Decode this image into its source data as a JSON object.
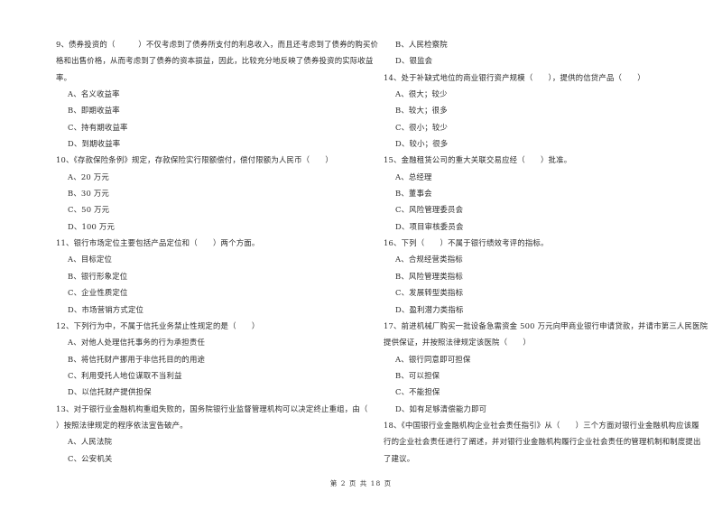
{
  "left_column": [
    {
      "type": "question",
      "lines": [
        "9、债券投资的（　　　）不仅考虑到了债券所支付的利息收入，而且还考虑到了债券的购买价",
        "格和出售价格，从而考虑到了债券的资本损益，因此，比较充分地反映了债券投资的实际收益",
        "率。"
      ]
    },
    {
      "type": "option",
      "text": "A、名义收益率"
    },
    {
      "type": "option",
      "text": "B、即期收益率"
    },
    {
      "type": "option",
      "text": "C、持有期收益率"
    },
    {
      "type": "option",
      "text": "D、到期收益率"
    },
    {
      "type": "question",
      "lines": [
        "10、《存款保险条例》规定，存款保险实行限额偿付，偿付限额为人民币（　　）"
      ]
    },
    {
      "type": "option",
      "text": "A、20 万元"
    },
    {
      "type": "option",
      "text": "B、30 万元"
    },
    {
      "type": "option",
      "text": "C、50 万元"
    },
    {
      "type": "option",
      "text": "D、100 万元"
    },
    {
      "type": "question",
      "lines": [
        "11、银行市场定位主要包括产品定位和（　　）两个方面。"
      ]
    },
    {
      "type": "option",
      "text": "A、目标定位"
    },
    {
      "type": "option",
      "text": "B、银行形象定位"
    },
    {
      "type": "option",
      "text": "C、企业性质定位"
    },
    {
      "type": "option",
      "text": "D、市场营销方式定位"
    },
    {
      "type": "question",
      "lines": [
        "12、下列行为中，不属于信托业务禁止性规定的是（　　）"
      ]
    },
    {
      "type": "option",
      "text": "A、对他人处理信托事务的行为承担责任"
    },
    {
      "type": "option",
      "text": "B、将信托财产挪用于非信托目的的用途"
    },
    {
      "type": "option",
      "text": "C、利用受托人地位谋取不当利益"
    },
    {
      "type": "option",
      "text": "D、以信托财产提供担保"
    },
    {
      "type": "question",
      "lines": [
        "13、对于银行业金融机构重组失败的，国务院银行业监督管理机构可以决定终止重组，由（",
        "）按照法律规定的程序依法宣告破产。"
      ]
    },
    {
      "type": "option",
      "text": "A、人民法院"
    },
    {
      "type": "option",
      "text": "C、公安机关"
    }
  ],
  "right_column": [
    {
      "type": "option",
      "text": "B、人民检察院"
    },
    {
      "type": "option",
      "text": "D、银监会"
    },
    {
      "type": "question",
      "lines": [
        "14、处于补缺式地位的商业银行资产规模（　　），提供的信贷产品（　　）"
      ]
    },
    {
      "type": "option",
      "text": "A、很大；较少"
    },
    {
      "type": "option",
      "text": "B、较大；很多"
    },
    {
      "type": "option",
      "text": "C、很小；较少"
    },
    {
      "type": "option",
      "text": "D、较小；很多"
    },
    {
      "type": "question",
      "lines": [
        "15、金融租赁公司的重大关联交易应经（　　）批准。"
      ]
    },
    {
      "type": "option",
      "text": "A、总经理"
    },
    {
      "type": "option",
      "text": "B、董事会"
    },
    {
      "type": "option",
      "text": "C、风险管理委员会"
    },
    {
      "type": "option",
      "text": "D、项目审核委员会"
    },
    {
      "type": "question",
      "lines": [
        "16、下列（　　）不属于银行绩效考评的指标。"
      ]
    },
    {
      "type": "option",
      "text": "A、合规经营类指标"
    },
    {
      "type": "option",
      "text": "B、风险管理类指标"
    },
    {
      "type": "option",
      "text": "C、发展转型类指标"
    },
    {
      "type": "option",
      "text": "D、盈利潜力类指标"
    },
    {
      "type": "question",
      "lines": [
        "17、前进机械厂购买一批设备急需资金 500 万元向甲商业银行申请贷款，并请市第三人民医院",
        "提供保证，并按照法律规定该医院（　　）"
      ]
    },
    {
      "type": "option",
      "text": "A、银行同意即可担保"
    },
    {
      "type": "option",
      "text": "B、可以担保"
    },
    {
      "type": "option",
      "text": "C、不能担保"
    },
    {
      "type": "option",
      "text": "D、如有足够清偿能力即可"
    },
    {
      "type": "question",
      "lines": [
        "18、《中国银行业金融机构企业社会责任指引》从（　　）三个方面对银行业金融机构应该履",
        "行的企业社会责任进行了阐述，并对银行业金融机构履行企业社会责任的管理机制和制度提出",
        "了建议。"
      ]
    }
  ],
  "footer": {
    "page_label": "第 2 页 共 18 页"
  }
}
